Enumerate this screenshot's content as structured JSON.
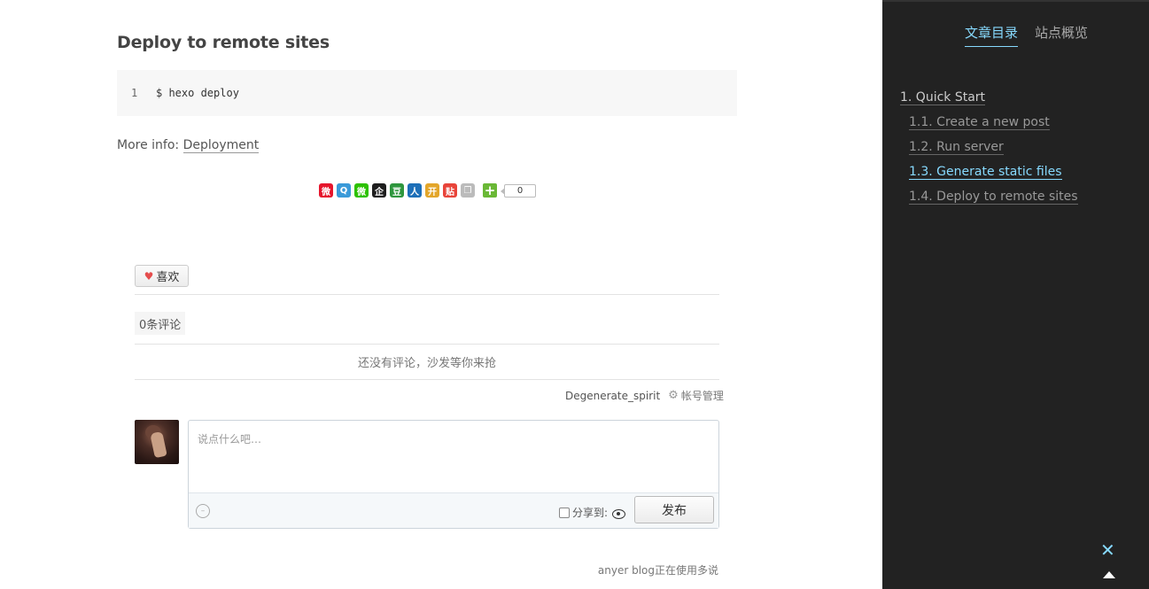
{
  "post": {
    "heading": "Deploy to remote sites",
    "code_line_number": "1",
    "code_text": "$ hexo deploy",
    "more_info_label": "More info: ",
    "more_info_link": "Deployment"
  },
  "share_bar": {
    "icons": [
      {
        "name": "weibo-share-icon",
        "glyph": "微",
        "color": "#e6162d"
      },
      {
        "name": "qzone-share-icon",
        "glyph": "Q",
        "color": "#3a9ad9"
      },
      {
        "name": "wechat-share-icon",
        "glyph": "微",
        "color": "#2dc100"
      },
      {
        "name": "qq-share-icon",
        "glyph": "企",
        "color": "#1e1e1e"
      },
      {
        "name": "douban-share-icon",
        "glyph": "豆",
        "color": "#2e963d"
      },
      {
        "name": "renren-share-icon",
        "glyph": "人",
        "color": "#1d6fb8"
      },
      {
        "name": "kaixin-share-icon",
        "glyph": "开",
        "color": "#e3a62a"
      },
      {
        "name": "tieba-share-icon",
        "glyph": "贴",
        "color": "#e8443a"
      },
      {
        "name": "copy-share-icon",
        "glyph": "❐",
        "color": "#bbbbbb"
      }
    ],
    "plus_glyph": "+",
    "count": "0"
  },
  "comments": {
    "like_label": "喜欢",
    "count_label": "0条评论",
    "empty_message": "还没有评论，沙发等你来抢",
    "username": "Degenerate_spirit",
    "account_manage_label": "帐号管理",
    "textarea_placeholder": "说点什么吧…",
    "share_to_label": "分享到:",
    "publish_label": "发布",
    "powered_by": "anyer blog正在使用多说"
  },
  "sidebar": {
    "tabs": [
      {
        "label": "文章目录",
        "active": true
      },
      {
        "label": "站点概览",
        "active": false
      }
    ],
    "toc": [
      {
        "label": "1. Quick Start",
        "level": 1,
        "active": false
      },
      {
        "label": "1.1. Create a new post",
        "level": 2,
        "active": false
      },
      {
        "label": "1.2. Run server",
        "level": 2,
        "active": false
      },
      {
        "label": "1.3. Generate static files",
        "level": 2,
        "active": true
      },
      {
        "label": "1.4. Deploy to remote sites",
        "level": 2,
        "active": false
      }
    ]
  },
  "colors": {
    "sidebar_bg": "#222222",
    "accent": "#87daff",
    "code_bg": "#f7f7f7"
  }
}
